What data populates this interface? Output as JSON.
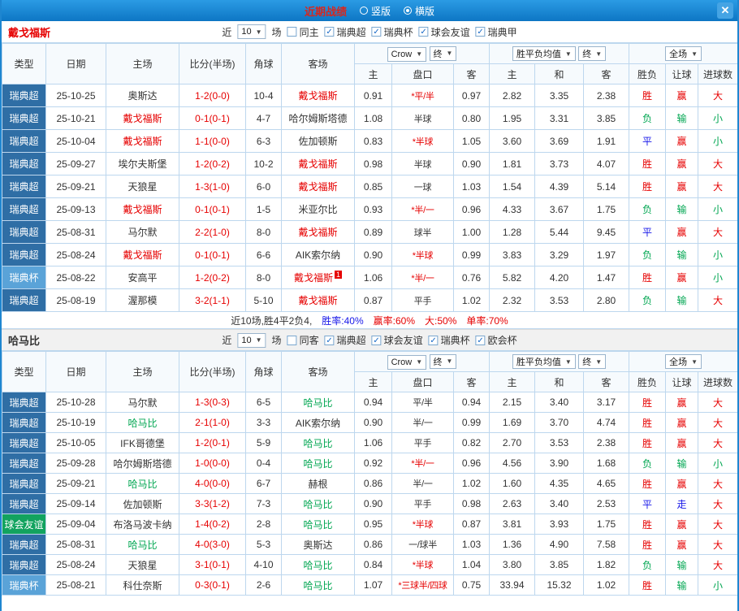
{
  "ui": {
    "dropdown_arrow": "▼",
    "check_glyph": "✓"
  },
  "colors": {
    "titlebar_bg": "#1585d8",
    "win_red": "#e60000",
    "lose_green": "#00a651",
    "draw_blue": "#1717e8",
    "league_allsvenskan_bg": "#2f6ea5",
    "league_cup_bg": "#5aa3d8",
    "league_friendly_bg": "#12a35f"
  },
  "titlebar": {
    "title": "近期战绩",
    "title_color": "#d9261c",
    "radio_vertical": "竖版",
    "radio_horizontal": "横版",
    "close": "✕"
  },
  "columns": [
    "类型",
    "日期",
    "主场",
    "比分(半场)",
    "角球",
    "客场",
    "主",
    "盘口",
    "客",
    "主",
    "和",
    "客",
    "胜负",
    "让球",
    "进球数"
  ],
  "sections": [
    {
      "team": "戴戈福斯",
      "team_color": "#e60000",
      "near": "近",
      "count": "10",
      "games": "场",
      "highlight": "red",
      "checkboxes": [
        {
          "label": "同主",
          "checked": false
        },
        {
          "label": "瑞典超",
          "checked": true
        },
        {
          "label": "瑞典杯",
          "checked": true
        },
        {
          "label": "球会友谊",
          "checked": true
        },
        {
          "label": "瑞典甲",
          "checked": true
        }
      ],
      "selects": {
        "s1": "Crow",
        "s2": "终",
        "s3": "胜平负均值",
        "s4": "终",
        "s5": "全场"
      },
      "rows": [
        {
          "t": "瑞典超",
          "tc": "sc",
          "d": "25-10-25",
          "h": "奥斯达",
          "hh": false,
          "s": "1-2(0-0)",
          "cn": "10-4",
          "a": "戴戈福斯",
          "ahl": true,
          "cd": "",
          "o1": "0.91",
          "hc": "*平/半",
          "o2": "0.97",
          "e1": "2.82",
          "e2": "3.35",
          "e3": "2.38",
          "r1": "胜",
          "c1": "w",
          "r2": "赢",
          "c2": "w",
          "r3": "大",
          "c3": "w"
        },
        {
          "t": "瑞典超",
          "tc": "sc",
          "d": "25-10-21",
          "h": "戴戈福斯",
          "hh": true,
          "s": "0-1(0-1)",
          "cn": "4-7",
          "a": "哈尔姆斯塔德",
          "ahl": false,
          "cd": "",
          "o1": "1.08",
          "hc": "半球",
          "o2": "0.80",
          "e1": "1.95",
          "e2": "3.31",
          "e3": "3.85",
          "r1": "负",
          "c1": "l",
          "r2": "输",
          "c2": "l",
          "r3": "小",
          "c3": "l"
        },
        {
          "t": "瑞典超",
          "tc": "sc",
          "d": "25-10-04",
          "h": "戴戈福斯",
          "hh": true,
          "s": "1-1(0-0)",
          "cn": "6-3",
          "a": "佐加顿斯",
          "ahl": false,
          "cd": "",
          "o1": "0.83",
          "hc": "*半球",
          "o2": "1.05",
          "e1": "3.60",
          "e2": "3.69",
          "e3": "1.91",
          "r1": "平",
          "c1": "d",
          "r2": "赢",
          "c2": "w",
          "r3": "小",
          "c3": "l"
        },
        {
          "t": "瑞典超",
          "tc": "sc",
          "d": "25-09-27",
          "h": "埃尔夫斯堡",
          "hh": false,
          "s": "1-2(0-2)",
          "cn": "10-2",
          "a": "戴戈福斯",
          "ahl": true,
          "cd": "",
          "o1": "0.98",
          "hc": "半球",
          "o2": "0.90",
          "e1": "1.81",
          "e2": "3.73",
          "e3": "4.07",
          "r1": "胜",
          "c1": "w",
          "r2": "赢",
          "c2": "w",
          "r3": "大",
          "c3": "w"
        },
        {
          "t": "瑞典超",
          "tc": "sc",
          "d": "25-09-21",
          "h": "天狼星",
          "hh": false,
          "s": "1-3(1-0)",
          "cn": "6-0",
          "a": "戴戈福斯",
          "ahl": true,
          "cd": "",
          "o1": "0.85",
          "hc": "一球",
          "o2": "1.03",
          "e1": "1.54",
          "e2": "4.39",
          "e3": "5.14",
          "r1": "胜",
          "c1": "w",
          "r2": "赢",
          "c2": "w",
          "r3": "大",
          "c3": "w"
        },
        {
          "t": "瑞典超",
          "tc": "sc",
          "d": "25-09-13",
          "h": "戴戈福斯",
          "hh": true,
          "s": "0-1(0-1)",
          "cn": "1-5",
          "a": "米亚尔比",
          "ahl": false,
          "cd": "",
          "o1": "0.93",
          "hc": "*半/一",
          "o2": "0.96",
          "e1": "4.33",
          "e2": "3.67",
          "e3": "1.75",
          "r1": "负",
          "c1": "l",
          "r2": "输",
          "c2": "l",
          "r3": "小",
          "c3": "l"
        },
        {
          "t": "瑞典超",
          "tc": "sc",
          "d": "25-08-31",
          "h": "马尔默",
          "hh": false,
          "s": "2-2(1-0)",
          "cn": "8-0",
          "a": "戴戈福斯",
          "ahl": true,
          "cd": "",
          "o1": "0.89",
          "hc": "球半",
          "o2": "1.00",
          "e1": "1.28",
          "e2": "5.44",
          "e3": "9.45",
          "r1": "平",
          "c1": "d",
          "r2": "赢",
          "c2": "w",
          "r3": "大",
          "c3": "w"
        },
        {
          "t": "瑞典超",
          "tc": "sc",
          "d": "25-08-24",
          "h": "戴戈福斯",
          "hh": true,
          "s": "0-1(0-1)",
          "cn": "6-6",
          "a": "AIK索尔纳",
          "ahl": false,
          "cd": "",
          "o1": "0.90",
          "hc": "*半球",
          "o2": "0.99",
          "e1": "3.83",
          "e2": "3.29",
          "e3": "1.97",
          "r1": "负",
          "c1": "l",
          "r2": "输",
          "c2": "l",
          "r3": "小",
          "c3": "l"
        },
        {
          "t": "瑞典杯",
          "tc": "cup",
          "d": "25-08-22",
          "h": "安高平",
          "hh": false,
          "s": "1-2(0-2)",
          "cn": "8-0",
          "a": "戴戈福斯",
          "ahl": true,
          "cd": "1",
          "o1": "1.06",
          "hc": "*半/一",
          "o2": "0.76",
          "e1": "5.82",
          "e2": "4.20",
          "e3": "1.47",
          "r1": "胜",
          "c1": "w",
          "r2": "赢",
          "c2": "w",
          "r3": "小",
          "c3": "l"
        },
        {
          "t": "瑞典超",
          "tc": "sc",
          "d": "25-08-19",
          "h": "渥那模",
          "hh": false,
          "s": "3-2(1-1)",
          "cn": "5-10",
          "a": "戴戈福斯",
          "ahl": true,
          "cd": "",
          "o1": "0.87",
          "hc": "平手",
          "o2": "1.02",
          "e1": "2.32",
          "e2": "3.53",
          "e3": "2.80",
          "r1": "负",
          "c1": "l",
          "r2": "输",
          "c2": "l",
          "r3": "大",
          "c3": "w"
        }
      ],
      "footer_prefix": "近10场,胜4平2负4,",
      "footer_stats": [
        {
          "text": "胜率:40%",
          "color": "#1717e8"
        },
        {
          "text": "赢率:60%",
          "color": "#e60000"
        },
        {
          "text": "大:50%",
          "color": "#e60000"
        },
        {
          "text": "单率:70%",
          "color": "#e60000"
        }
      ]
    },
    {
      "team": "哈马比",
      "team_color": "#333333",
      "near": "近",
      "count": "10",
      "games": "场",
      "highlight": "green",
      "checkboxes": [
        {
          "label": "同客",
          "checked": false
        },
        {
          "label": "瑞典超",
          "checked": true
        },
        {
          "label": "球会友谊",
          "checked": true
        },
        {
          "label": "瑞典杯",
          "checked": true
        },
        {
          "label": "欧会杯",
          "checked": true
        }
      ],
      "selects": {
        "s1": "Crow",
        "s2": "终",
        "s3": "胜平负均值",
        "s4": "终",
        "s5": "全场"
      },
      "rows": [
        {
          "t": "瑞典超",
          "tc": "sc",
          "d": "25-10-28",
          "h": "马尔默",
          "hh": false,
          "s": "1-3(0-3)",
          "cn": "6-5",
          "a": "哈马比",
          "ahl": true,
          "cd": "",
          "o1": "0.94",
          "hc": "平/半",
          "o2": "0.94",
          "e1": "2.15",
          "e2": "3.40",
          "e3": "3.17",
          "r1": "胜",
          "c1": "w",
          "r2": "赢",
          "c2": "w",
          "r3": "大",
          "c3": "w"
        },
        {
          "t": "瑞典超",
          "tc": "sc",
          "d": "25-10-19",
          "h": "哈马比",
          "hh": true,
          "s": "2-1(1-0)",
          "cn": "3-3",
          "a": "AIK索尔纳",
          "ahl": false,
          "cd": "",
          "o1": "0.90",
          "hc": "半/一",
          "o2": "0.99",
          "e1": "1.69",
          "e2": "3.70",
          "e3": "4.74",
          "r1": "胜",
          "c1": "w",
          "r2": "赢",
          "c2": "w",
          "r3": "大",
          "c3": "w"
        },
        {
          "t": "瑞典超",
          "tc": "sc",
          "d": "25-10-05",
          "h": "IFK哥德堡",
          "hh": false,
          "s": "1-2(0-1)",
          "cn": "5-9",
          "a": "哈马比",
          "ahl": true,
          "cd": "",
          "o1": "1.06",
          "hc": "平手",
          "o2": "0.82",
          "e1": "2.70",
          "e2": "3.53",
          "e3": "2.38",
          "r1": "胜",
          "c1": "w",
          "r2": "赢",
          "c2": "w",
          "r3": "大",
          "c3": "w"
        },
        {
          "t": "瑞典超",
          "tc": "sc",
          "d": "25-09-28",
          "h": "哈尔姆斯塔德",
          "hh": false,
          "s": "1-0(0-0)",
          "cn": "0-4",
          "a": "哈马比",
          "ahl": true,
          "cd": "",
          "o1": "0.92",
          "hc": "*半/一",
          "o2": "0.96",
          "e1": "4.56",
          "e2": "3.90",
          "e3": "1.68",
          "r1": "负",
          "c1": "l",
          "r2": "输",
          "c2": "l",
          "r3": "小",
          "c3": "l"
        },
        {
          "t": "瑞典超",
          "tc": "sc",
          "d": "25-09-21",
          "h": "哈马比",
          "hh": true,
          "s": "4-0(0-0)",
          "cn": "6-7",
          "a": "赫根",
          "ahl": false,
          "cd": "",
          "o1": "0.86",
          "hc": "半/一",
          "o2": "1.02",
          "e1": "1.60",
          "e2": "4.35",
          "e3": "4.65",
          "r1": "胜",
          "c1": "w",
          "r2": "赢",
          "c2": "w",
          "r3": "大",
          "c3": "w"
        },
        {
          "t": "瑞典超",
          "tc": "sc",
          "d": "25-09-14",
          "h": "佐加顿斯",
          "hh": false,
          "s": "3-3(1-2)",
          "cn": "7-3",
          "a": "哈马比",
          "ahl": true,
          "cd": "",
          "o1": "0.90",
          "hc": "平手",
          "o2": "0.98",
          "e1": "2.63",
          "e2": "3.40",
          "e3": "2.53",
          "r1": "平",
          "c1": "d",
          "r2": "走",
          "c2": "d",
          "r3": "大",
          "c3": "w"
        },
        {
          "t": "球会友谊",
          "tc": "fr",
          "d": "25-09-04",
          "h": "布洛马波卡纳",
          "hh": false,
          "s": "1-4(0-2)",
          "cn": "2-8",
          "a": "哈马比",
          "ahl": true,
          "cd": "",
          "o1": "0.95",
          "hc": "*半球",
          "o2": "0.87",
          "e1": "3.81",
          "e2": "3.93",
          "e3": "1.75",
          "r1": "胜",
          "c1": "w",
          "r2": "赢",
          "c2": "w",
          "r3": "大",
          "c3": "w"
        },
        {
          "t": "瑞典超",
          "tc": "sc",
          "d": "25-08-31",
          "h": "哈马比",
          "hh": true,
          "s": "4-0(3-0)",
          "cn": "5-3",
          "a": "奥斯达",
          "ahl": false,
          "cd": "",
          "o1": "0.86",
          "hc": "一/球半",
          "o2": "1.03",
          "e1": "1.36",
          "e2": "4.90",
          "e3": "7.58",
          "r1": "胜",
          "c1": "w",
          "r2": "赢",
          "c2": "w",
          "r3": "大",
          "c3": "w"
        },
        {
          "t": "瑞典超",
          "tc": "sc",
          "d": "25-08-24",
          "h": "天狼星",
          "hh": false,
          "s": "3-1(0-1)",
          "cn": "4-10",
          "a": "哈马比",
          "ahl": true,
          "cd": "",
          "o1": "0.84",
          "hc": "*半球",
          "o2": "1.04",
          "e1": "3.80",
          "e2": "3.85",
          "e3": "1.82",
          "r1": "负",
          "c1": "l",
          "r2": "输",
          "c2": "l",
          "r3": "大",
          "c3": "w"
        },
        {
          "t": "瑞典杯",
          "tc": "cup",
          "d": "25-08-21",
          "h": "科仕奈斯",
          "hh": false,
          "s": "0-3(0-1)",
          "cn": "2-6",
          "a": "哈马比",
          "ahl": true,
          "cd": "",
          "o1": "1.07",
          "hc": "*三球半/四球",
          "o2": "0.75",
          "e1": "33.94",
          "e2": "15.32",
          "e3": "1.02",
          "r1": "胜",
          "c1": "w",
          "r2": "输",
          "c2": "l",
          "r3": "小",
          "c3": "l"
        }
      ]
    }
  ]
}
